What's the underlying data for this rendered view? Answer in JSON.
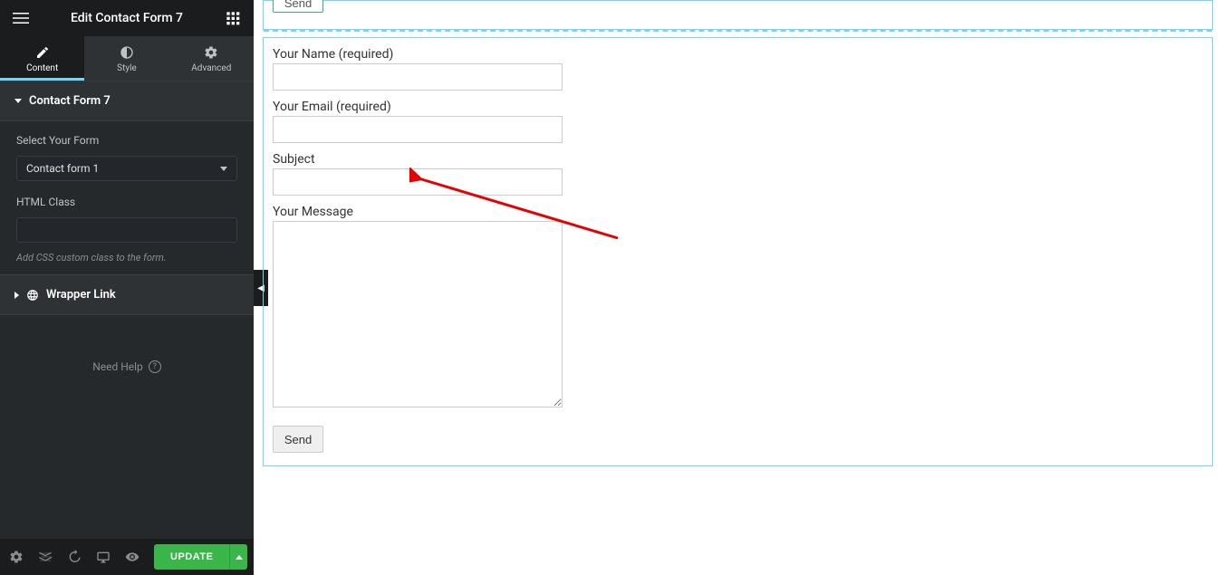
{
  "header": {
    "title": "Edit Contact Form 7"
  },
  "tabs": {
    "content": "Content",
    "style": "Style",
    "advanced": "Advanced"
  },
  "section1": {
    "title": "Contact Form 7",
    "field_select_label": "Select Your Form",
    "select_value": "Contact form 1",
    "field_class_label": "HTML Class",
    "class_value": "",
    "hint": "Add CSS custom class to the form."
  },
  "section2": {
    "title": "Wrapper Link"
  },
  "help": {
    "label": "Need Help"
  },
  "footer": {
    "update": "UPDATE"
  },
  "canvas": {
    "send_top": "Send",
    "form": {
      "name_label": "Your Name (required)",
      "email_label": "Your Email (required)",
      "subject_label": "Subject",
      "message_label": "Your Message",
      "send": "Send"
    }
  }
}
